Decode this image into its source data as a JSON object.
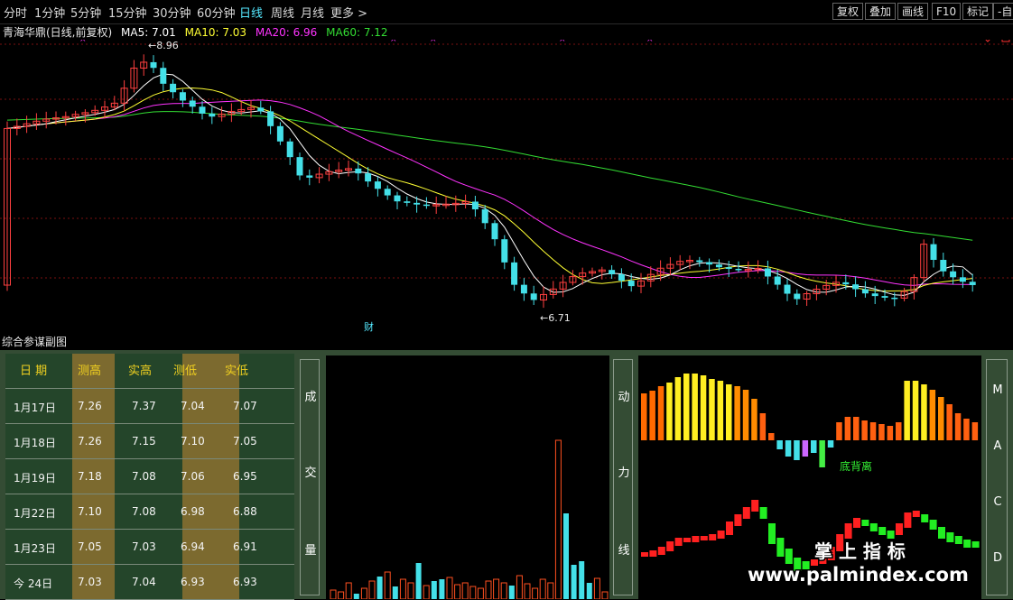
{
  "top_bar": {
    "periods": [
      "分时",
      "1分钟",
      "5分钟",
      "15分钟",
      "30分钟",
      "60分钟",
      "日线",
      "周线",
      "月线",
      "更多 >"
    ],
    "active_period": "日线",
    "tools": [
      "复权",
      "叠加",
      "画线",
      "F10",
      "标记",
      "-自"
    ]
  },
  "main_chart": {
    "stock_name": "青海华鼎(日线,前复权)",
    "ma_labels": [
      {
        "text": "MA5: 7.01",
        "color": "#ffffff"
      },
      {
        "text": "MA10: 7.03",
        "color": "#ffff33"
      },
      {
        "text": "MA20: 6.96",
        "color": "#ff33ff"
      },
      {
        "text": "MA60: 7.12",
        "color": "#33dd33"
      }
    ],
    "high_mark": "8.96",
    "low_mark": "6.71",
    "fin_marker": "财",
    "colors": {
      "up": "#ff4040",
      "down": "#44e0e8",
      "ma5": "#ffffff",
      "ma10": "#ffff33",
      "ma20": "#ff33ff",
      "ma60": "#33dd33",
      "grid": "#7a1010"
    }
  },
  "sub_title": "综合参谋副图",
  "table": {
    "headers": [
      "日 期",
      "测高",
      "实高",
      "测低",
      "实低"
    ],
    "rows": [
      {
        "date": "1月17日",
        "values": [
          "7.26",
          "7.37",
          "7.04",
          "7.07"
        ]
      },
      {
        "date": "1月18日",
        "values": [
          "7.26",
          "7.15",
          "7.10",
          "7.05"
        ]
      },
      {
        "date": "1月19日",
        "values": [
          "7.18",
          "7.08",
          "7.06",
          "6.95"
        ]
      },
      {
        "date": "1月22日",
        "values": [
          "7.10",
          "7.08",
          "6.98",
          "6.88"
        ]
      },
      {
        "date": "1月23日",
        "values": [
          "7.05",
          "7.03",
          "6.94",
          "6.91"
        ]
      },
      {
        "date": "今 24日",
        "values": [
          "7.03",
          "7.04",
          "6.93",
          "6.93"
        ]
      }
    ]
  },
  "panel_labels": {
    "volume": [
      "成",
      "交",
      "量"
    ],
    "momentum": [
      "动",
      "力",
      "线"
    ],
    "macd": [
      "M",
      "A",
      "C",
      "D"
    ]
  },
  "macd_annotation": "底背离",
  "watermark": {
    "cn": "掌 上 指 标",
    "url": "www.palmindex.com"
  }
}
